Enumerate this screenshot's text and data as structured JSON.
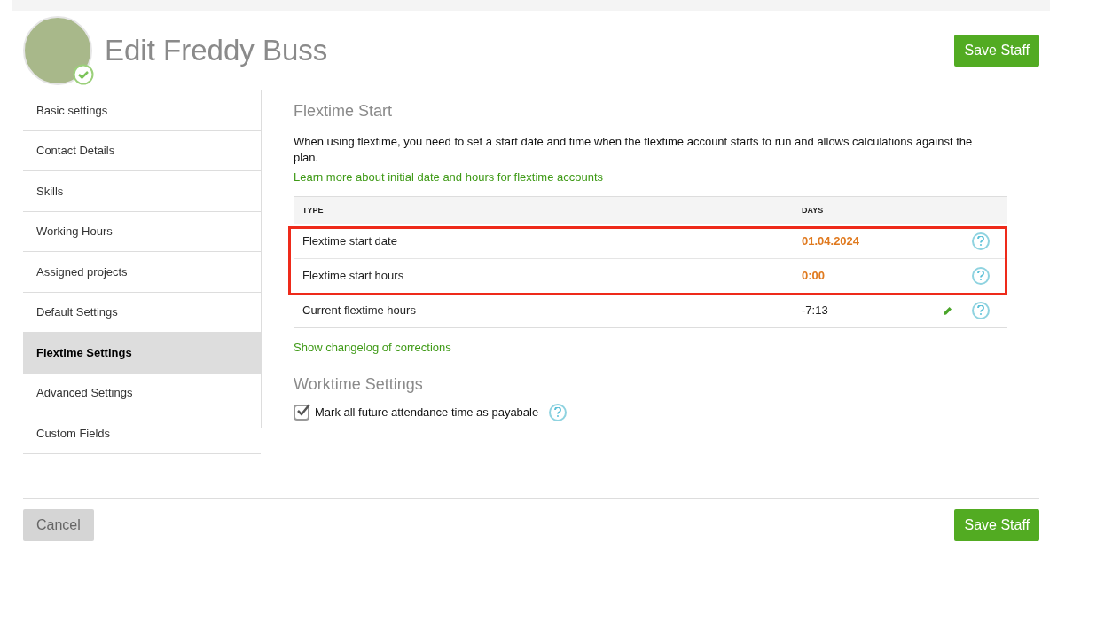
{
  "header": {
    "title": "Edit Freddy Buss",
    "verified": true,
    "save_button": "Save Staff"
  },
  "sidebar": {
    "items": [
      {
        "label": "Basic settings",
        "selected": false
      },
      {
        "label": "Contact Details",
        "selected": false
      },
      {
        "label": "Skills",
        "selected": false
      },
      {
        "label": "Working Hours",
        "selected": false
      },
      {
        "label": "Assigned projects",
        "selected": false
      },
      {
        "label": "Default Settings",
        "selected": false
      },
      {
        "label": "Flextime Settings",
        "selected": true
      },
      {
        "label": "Advanced Settings",
        "selected": false
      },
      {
        "label": "Custom Fields",
        "selected": false
      }
    ]
  },
  "flextime": {
    "title": "Flextime Start",
    "description": "When using flextime, you need to set a start date and time when the flextime account starts to run and allows calculations against the plan.",
    "link": "Learn more about initial date and hours for flextime accounts",
    "table": {
      "columns": [
        "TYPE",
        "DAYS"
      ],
      "rows": [
        {
          "type": "Flextime start date",
          "days": "01.04.2024",
          "highlighted": true,
          "editable": false
        },
        {
          "type": "Flextime start hours",
          "days": "0:00",
          "highlighted": true,
          "editable": false
        },
        {
          "type": "Current flextime hours",
          "days": "-7:13",
          "highlighted": false,
          "editable": true
        }
      ]
    },
    "changelog_link": "Show changelog of corrections"
  },
  "worktime": {
    "title": "Worktime Settings",
    "checkbox": {
      "label": "Mark all future attendance time as payabale",
      "checked": true
    }
  },
  "footer": {
    "cancel": "Cancel",
    "save": "Save Staff"
  }
}
